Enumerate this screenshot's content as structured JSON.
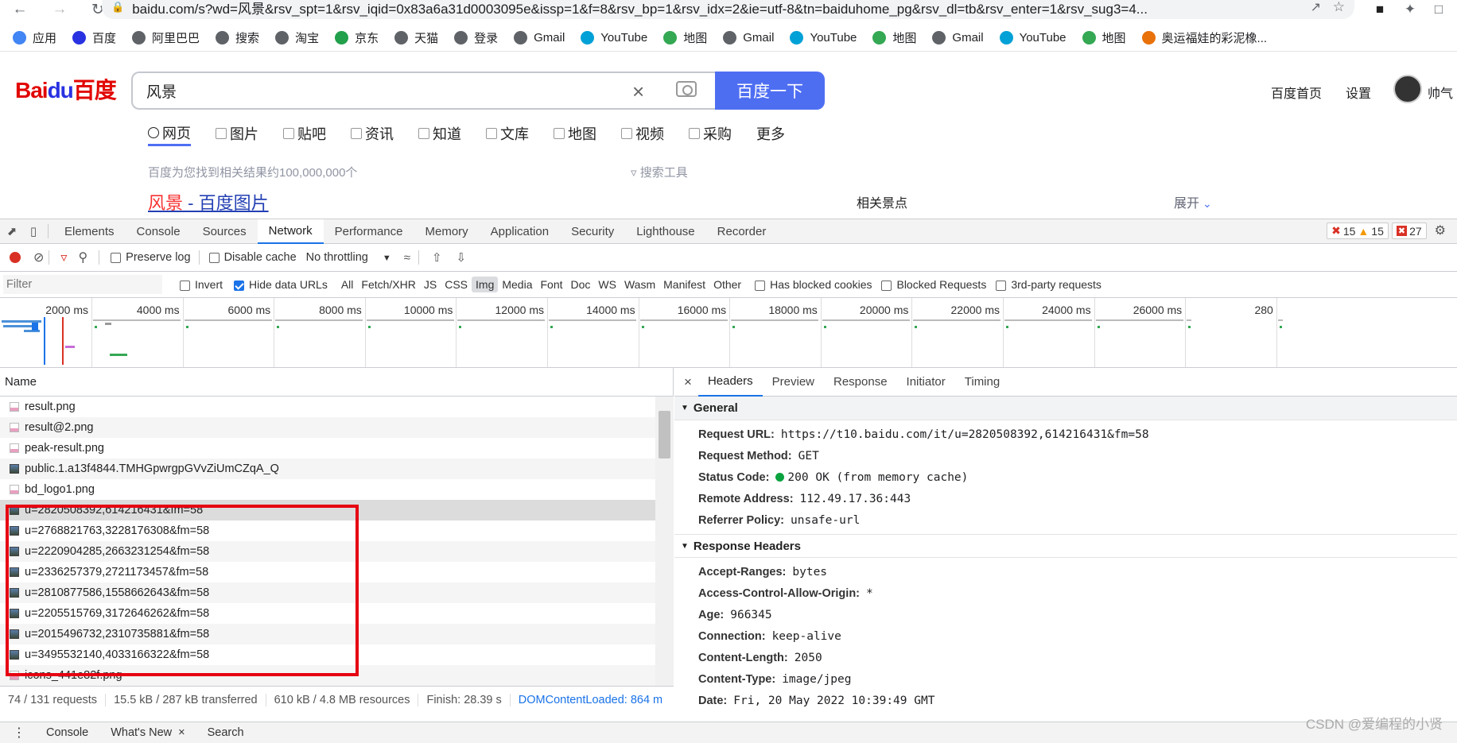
{
  "browser": {
    "url": "baidu.com/s?wd=风景&rsv_spt=1&rsv_iqid=0x83a6a31d0003095e&issp=1&f=8&rsv_bp=1&rsv_idx=2&ie=utf-8&tn=baiduhome_pg&rsv_dl=tb&rsv_enter=1&rsv_sug3=4...",
    "bookmarks": [
      {
        "label": "应用",
        "icon": "apps-grid-icon",
        "color": "#4285f4"
      },
      {
        "label": "百度",
        "icon": "baidu-paw-icon",
        "color": "#2932e1"
      },
      {
        "label": "阿里巴巴",
        "icon": "globe-icon",
        "color": "#5f6368"
      },
      {
        "label": "搜索",
        "icon": "globe-icon",
        "color": "#5f6368"
      },
      {
        "label": "淘宝",
        "icon": "globe-icon",
        "color": "#5f6368"
      },
      {
        "label": "京东",
        "icon": "jd-icon",
        "color": "#22a04b"
      },
      {
        "label": "天猫",
        "icon": "globe-icon",
        "color": "#5f6368"
      },
      {
        "label": "登录",
        "icon": "globe-icon",
        "color": "#5f6368"
      },
      {
        "label": "Gmail",
        "icon": "globe-icon",
        "color": "#5f6368"
      },
      {
        "label": "YouTube",
        "icon": "bilibili-tv-icon",
        "color": "#00a1d6"
      },
      {
        "label": "地图",
        "icon": "map-icon",
        "color": "#34a853"
      },
      {
        "label": "Gmail",
        "icon": "globe-icon",
        "color": "#5f6368"
      },
      {
        "label": "YouTube",
        "icon": "bilibili-tv-icon",
        "color": "#00a1d6"
      },
      {
        "label": "地图",
        "icon": "map-icon",
        "color": "#34a853"
      },
      {
        "label": "Gmail",
        "icon": "globe-icon",
        "color": "#5f6368"
      },
      {
        "label": "YouTube",
        "icon": "bilibili-tv-icon",
        "color": "#00a1d6"
      },
      {
        "label": "地图",
        "icon": "map-icon",
        "color": "#34a853"
      },
      {
        "label": "奥运福娃的彩泥橡...",
        "icon": "flower-icon",
        "color": "#e8710a"
      }
    ]
  },
  "baidu": {
    "logo_text_1": "Bai",
    "logo_text_2": "du",
    "logo_text_3": "百度",
    "search_value": "风景",
    "search_button": "百度一下",
    "home_link": "百度首页",
    "settings_link": "设置",
    "username": "帅气",
    "tabs": [
      {
        "label": "网页",
        "active": true
      },
      {
        "label": "图片",
        "active": false
      },
      {
        "label": "贴吧",
        "active": false
      },
      {
        "label": "资讯",
        "active": false
      },
      {
        "label": "知道",
        "active": false
      },
      {
        "label": "文库",
        "active": false
      },
      {
        "label": "地图",
        "active": false
      },
      {
        "label": "视频",
        "active": false
      },
      {
        "label": "采购",
        "active": false
      },
      {
        "label": "更多",
        "active": false
      }
    ],
    "result_count": "百度为您找到相关结果约100,000,000个",
    "search_tools": "搜索工具",
    "result_title_red": "风景",
    "result_title_rest": " - 百度图片",
    "related_scenic": "相关景点",
    "expand": "展开"
  },
  "devtools": {
    "tabs": [
      "Elements",
      "Console",
      "Sources",
      "Network",
      "Performance",
      "Memory",
      "Application",
      "Security",
      "Lighthouse",
      "Recorder"
    ],
    "active_tab": "Network",
    "errors": "15",
    "warnings": "15",
    "issues": "27",
    "toolbar": {
      "preserve_log": "Preserve log",
      "disable_cache": "Disable cache",
      "throttling": "No throttling"
    },
    "filter": {
      "placeholder": "Filter",
      "invert": "Invert",
      "hide_data_urls": "Hide data URLs",
      "types": [
        "All",
        "Fetch/XHR",
        "JS",
        "CSS",
        "Img",
        "Media",
        "Font",
        "Doc",
        "WS",
        "Wasm",
        "Manifest",
        "Other"
      ],
      "active_type": "Img",
      "has_blocked_cookies": "Has blocked cookies",
      "blocked_requests": "Blocked Requests",
      "third_party": "3rd-party requests"
    },
    "timeline_ticks": [
      "2000 ms",
      "4000 ms",
      "6000 ms",
      "8000 ms",
      "10000 ms",
      "12000 ms",
      "14000 ms",
      "16000 ms",
      "18000 ms",
      "20000 ms",
      "22000 ms",
      "24000 ms",
      "26000 ms",
      "280"
    ],
    "name_header": "Name",
    "requests": [
      {
        "name": "result.png",
        "icon": "png-file-icon"
      },
      {
        "name": "result@2.png",
        "icon": "png-file-icon"
      },
      {
        "name": "peak-result.png",
        "icon": "png-file-icon"
      },
      {
        "name": "public.1.a13f4844.TMHGpwrgpGVvZiUmCZqA_Q",
        "icon": "image-thumb-icon"
      },
      {
        "name": "bd_logo1.png",
        "icon": "png-file-icon"
      },
      {
        "name": "u=2820508392,614216431&fm=58",
        "icon": "image-thumb-icon",
        "selected": true
      },
      {
        "name": "u=2768821763,3228176308&fm=58",
        "icon": "image-thumb-icon"
      },
      {
        "name": "u=2220904285,2663231254&fm=58",
        "icon": "image-thumb-icon"
      },
      {
        "name": "u=2336257379,2721173457&fm=58",
        "icon": "image-thumb-icon"
      },
      {
        "name": "u=2810877586,1558662643&fm=58",
        "icon": "image-thumb-icon"
      },
      {
        "name": "u=2205515769,3172646262&fm=58",
        "icon": "image-thumb-icon"
      },
      {
        "name": "u=2015496732,2310735881&fm=58",
        "icon": "image-thumb-icon"
      },
      {
        "name": "u=3495532140,4033166322&fm=58",
        "icon": "image-thumb-icon"
      },
      {
        "name": "icons_441e82f.png",
        "icon": "png-file-icon"
      }
    ],
    "status": {
      "requests": "74 / 131 requests",
      "transferred": "15.5 kB / 287 kB transferred",
      "resources": "610 kB / 4.8 MB resources",
      "finish": "Finish: 28.39 s",
      "dcl": "DOMContentLoaded: 864 m"
    },
    "detail_tabs": [
      "Headers",
      "Preview",
      "Response",
      "Initiator",
      "Timing"
    ],
    "detail_active": "Headers",
    "general_title": "General",
    "general": [
      {
        "k": "Request URL:",
        "v": "https://t10.baidu.com/it/u=2820508392,614216431&fm=58"
      },
      {
        "k": "Request Method:",
        "v": "GET"
      },
      {
        "k": "Status Code:",
        "v": "200 OK (from memory cache)",
        "status": true
      },
      {
        "k": "Remote Address:",
        "v": "112.49.17.36:443"
      },
      {
        "k": "Referrer Policy:",
        "v": "unsafe-url"
      }
    ],
    "response_title": "Response Headers",
    "response_headers": [
      {
        "k": "Accept-Ranges:",
        "v": "bytes"
      },
      {
        "k": "Access-Control-Allow-Origin:",
        "v": "*"
      },
      {
        "k": "Age:",
        "v": "966345"
      },
      {
        "k": "Connection:",
        "v": "keep-alive"
      },
      {
        "k": "Content-Length:",
        "v": "2050"
      },
      {
        "k": "Content-Type:",
        "v": "image/jpeg"
      },
      {
        "k": "Date:",
        "v": "Fri, 20 May 2022 10:39:49 GMT"
      }
    ],
    "drawer_tabs": [
      "Console",
      "What's New",
      "Search"
    ]
  },
  "watermark": "CSDN @爱编程的小贤"
}
